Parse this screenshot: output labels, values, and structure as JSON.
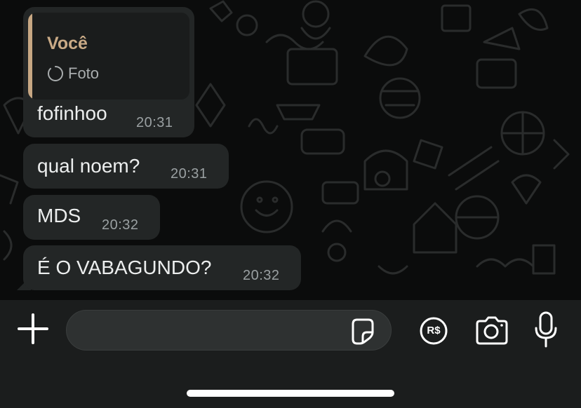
{
  "messages": [
    {
      "quoted": {
        "sender": "Você",
        "media_count": "1",
        "media_label": "Foto"
      },
      "text": "fofinhoo",
      "time": "20:31"
    },
    {
      "text": "qual noem?",
      "time": "20:31"
    },
    {
      "text": "MDS",
      "time": "20:32"
    },
    {
      "text": "É O VABAGUNDO?",
      "time": "20:32"
    }
  ],
  "composer": {
    "placeholder": "",
    "value": ""
  },
  "icons": {
    "attach": "plus-icon",
    "sticker": "sticker-icon",
    "payment": "currency-brl-icon",
    "payment_label": "R$",
    "camera": "camera-icon",
    "microphone": "microphone-icon"
  },
  "colors": {
    "background": "#0b0c0c",
    "bubble": "#232626",
    "quote_accent": "#c7a783",
    "input_bar": "#1b1d1d",
    "input_field": "#2e3131"
  }
}
